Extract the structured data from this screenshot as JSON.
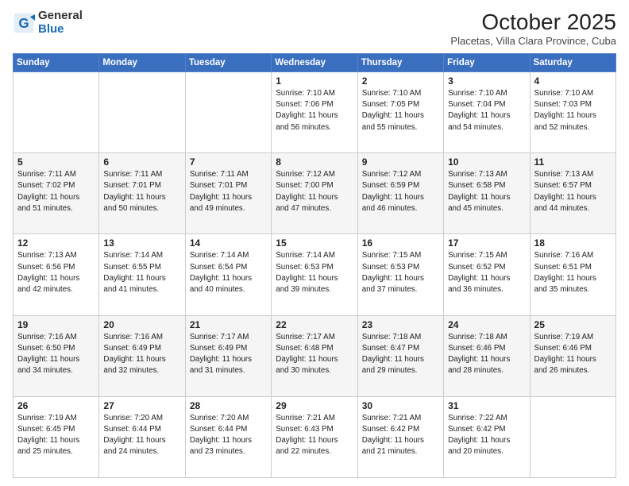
{
  "logo": {
    "general": "General",
    "blue": "Blue"
  },
  "title": "October 2025",
  "subtitle": "Placetas, Villa Clara Province, Cuba",
  "weekdays": [
    "Sunday",
    "Monday",
    "Tuesday",
    "Wednesday",
    "Thursday",
    "Friday",
    "Saturday"
  ],
  "weeks": [
    [
      {
        "day": "",
        "info": ""
      },
      {
        "day": "",
        "info": ""
      },
      {
        "day": "",
        "info": ""
      },
      {
        "day": "1",
        "info": "Sunrise: 7:10 AM\nSunset: 7:06 PM\nDaylight: 11 hours\nand 56 minutes."
      },
      {
        "day": "2",
        "info": "Sunrise: 7:10 AM\nSunset: 7:05 PM\nDaylight: 11 hours\nand 55 minutes."
      },
      {
        "day": "3",
        "info": "Sunrise: 7:10 AM\nSunset: 7:04 PM\nDaylight: 11 hours\nand 54 minutes."
      },
      {
        "day": "4",
        "info": "Sunrise: 7:10 AM\nSunset: 7:03 PM\nDaylight: 11 hours\nand 52 minutes."
      }
    ],
    [
      {
        "day": "5",
        "info": "Sunrise: 7:11 AM\nSunset: 7:02 PM\nDaylight: 11 hours\nand 51 minutes."
      },
      {
        "day": "6",
        "info": "Sunrise: 7:11 AM\nSunset: 7:01 PM\nDaylight: 11 hours\nand 50 minutes."
      },
      {
        "day": "7",
        "info": "Sunrise: 7:11 AM\nSunset: 7:01 PM\nDaylight: 11 hours\nand 49 minutes."
      },
      {
        "day": "8",
        "info": "Sunrise: 7:12 AM\nSunset: 7:00 PM\nDaylight: 11 hours\nand 47 minutes."
      },
      {
        "day": "9",
        "info": "Sunrise: 7:12 AM\nSunset: 6:59 PM\nDaylight: 11 hours\nand 46 minutes."
      },
      {
        "day": "10",
        "info": "Sunrise: 7:13 AM\nSunset: 6:58 PM\nDaylight: 11 hours\nand 45 minutes."
      },
      {
        "day": "11",
        "info": "Sunrise: 7:13 AM\nSunset: 6:57 PM\nDaylight: 11 hours\nand 44 minutes."
      }
    ],
    [
      {
        "day": "12",
        "info": "Sunrise: 7:13 AM\nSunset: 6:56 PM\nDaylight: 11 hours\nand 42 minutes."
      },
      {
        "day": "13",
        "info": "Sunrise: 7:14 AM\nSunset: 6:55 PM\nDaylight: 11 hours\nand 41 minutes."
      },
      {
        "day": "14",
        "info": "Sunrise: 7:14 AM\nSunset: 6:54 PM\nDaylight: 11 hours\nand 40 minutes."
      },
      {
        "day": "15",
        "info": "Sunrise: 7:14 AM\nSunset: 6:53 PM\nDaylight: 11 hours\nand 39 minutes."
      },
      {
        "day": "16",
        "info": "Sunrise: 7:15 AM\nSunset: 6:53 PM\nDaylight: 11 hours\nand 37 minutes."
      },
      {
        "day": "17",
        "info": "Sunrise: 7:15 AM\nSunset: 6:52 PM\nDaylight: 11 hours\nand 36 minutes."
      },
      {
        "day": "18",
        "info": "Sunrise: 7:16 AM\nSunset: 6:51 PM\nDaylight: 11 hours\nand 35 minutes."
      }
    ],
    [
      {
        "day": "19",
        "info": "Sunrise: 7:16 AM\nSunset: 6:50 PM\nDaylight: 11 hours\nand 34 minutes."
      },
      {
        "day": "20",
        "info": "Sunrise: 7:16 AM\nSunset: 6:49 PM\nDaylight: 11 hours\nand 32 minutes."
      },
      {
        "day": "21",
        "info": "Sunrise: 7:17 AM\nSunset: 6:49 PM\nDaylight: 11 hours\nand 31 minutes."
      },
      {
        "day": "22",
        "info": "Sunrise: 7:17 AM\nSunset: 6:48 PM\nDaylight: 11 hours\nand 30 minutes."
      },
      {
        "day": "23",
        "info": "Sunrise: 7:18 AM\nSunset: 6:47 PM\nDaylight: 11 hours\nand 29 minutes."
      },
      {
        "day": "24",
        "info": "Sunrise: 7:18 AM\nSunset: 6:46 PM\nDaylight: 11 hours\nand 28 minutes."
      },
      {
        "day": "25",
        "info": "Sunrise: 7:19 AM\nSunset: 6:46 PM\nDaylight: 11 hours\nand 26 minutes."
      }
    ],
    [
      {
        "day": "26",
        "info": "Sunrise: 7:19 AM\nSunset: 6:45 PM\nDaylight: 11 hours\nand 25 minutes."
      },
      {
        "day": "27",
        "info": "Sunrise: 7:20 AM\nSunset: 6:44 PM\nDaylight: 11 hours\nand 24 minutes."
      },
      {
        "day": "28",
        "info": "Sunrise: 7:20 AM\nSunset: 6:44 PM\nDaylight: 11 hours\nand 23 minutes."
      },
      {
        "day": "29",
        "info": "Sunrise: 7:21 AM\nSunset: 6:43 PM\nDaylight: 11 hours\nand 22 minutes."
      },
      {
        "day": "30",
        "info": "Sunrise: 7:21 AM\nSunset: 6:42 PM\nDaylight: 11 hours\nand 21 minutes."
      },
      {
        "day": "31",
        "info": "Sunrise: 7:22 AM\nSunset: 6:42 PM\nDaylight: 11 hours\nand 20 minutes."
      },
      {
        "day": "",
        "info": ""
      }
    ]
  ]
}
